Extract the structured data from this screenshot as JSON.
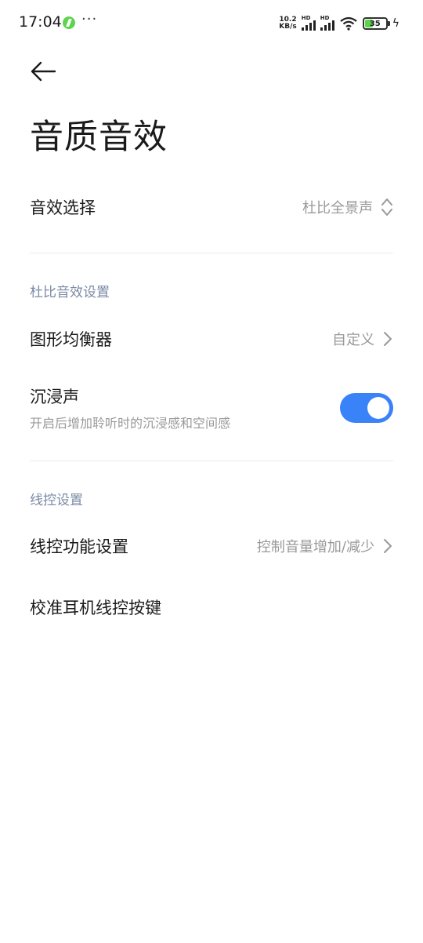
{
  "status_bar": {
    "time": "17:04",
    "more": "···",
    "net_speed_value": "10.2",
    "net_speed_unit": "KB/s",
    "signal_label_1": "HD",
    "signal_label_2": "HD",
    "battery_level": "35",
    "icons": [
      "app-notification-icon",
      "signal-icon",
      "wifi-icon",
      "battery-icon",
      "charging-icon"
    ]
  },
  "header": {
    "back_icon": "back-arrow-icon",
    "title": "音质音效"
  },
  "effect_select": {
    "label": "音效选择",
    "value": "杜比全景声"
  },
  "dolby_section": {
    "header": "杜比音效设置",
    "equalizer_label": "图形均衡器",
    "equalizer_value": "自定义",
    "immersive_label": "沉浸声",
    "immersive_desc": "开启后增加聆听时的沉浸感和空间感",
    "immersive_on": true
  },
  "wire_section": {
    "header": "线控设置",
    "function_label": "线控功能设置",
    "function_value": "控制音量增加/减少",
    "calibrate_label": "校准耳机线控按键"
  },
  "colors": {
    "accent": "#3a82f7",
    "section_header": "#7b8aa6",
    "secondary_text": "#999999"
  }
}
